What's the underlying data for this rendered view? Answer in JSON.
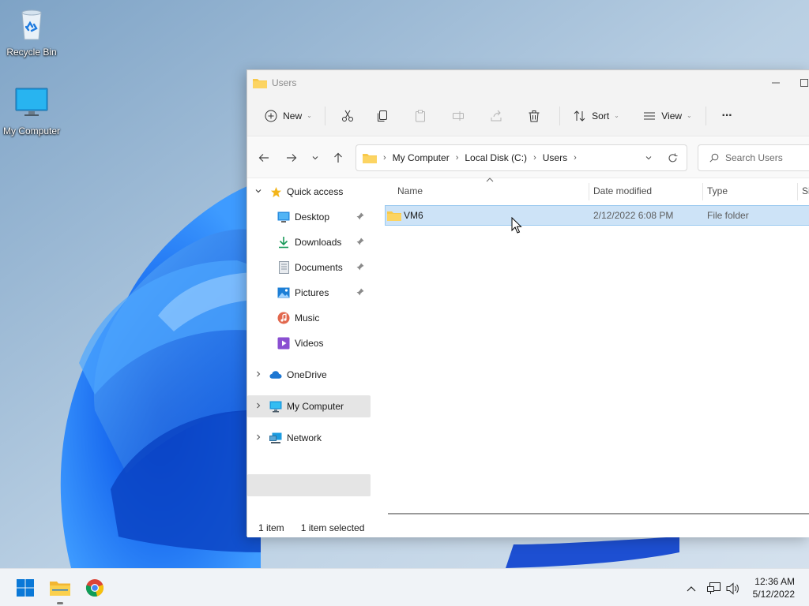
{
  "desktop": {
    "icons": [
      {
        "label": "Recycle Bin",
        "icon": "recycle-bin-icon"
      },
      {
        "label": "My Computer",
        "icon": "monitor-icon"
      }
    ]
  },
  "window": {
    "title": "Users",
    "controls": {
      "minimize": "minimize-icon",
      "maximize": "maximize-icon"
    }
  },
  "toolbar": {
    "new_label": "New",
    "sort_label": "Sort",
    "view_label": "View",
    "more_label": "···",
    "icons": [
      "plus-circle-icon",
      "cut-icon",
      "copy-icon",
      "paste-icon",
      "rename-icon",
      "share-icon",
      "delete-icon",
      "sort-icon",
      "view-icon",
      "more-icon"
    ]
  },
  "address": {
    "crumbs": [
      "My Computer",
      "Local Disk (C:)",
      "Users"
    ],
    "search_placeholder": "Search Users"
  },
  "navpane": {
    "items": [
      {
        "label": "Quick access",
        "icon": "star-icon"
      },
      {
        "label": "Desktop",
        "icon": "desktop-icon",
        "pinned": true
      },
      {
        "label": "Downloads",
        "icon": "download-icon",
        "pinned": true
      },
      {
        "label": "Documents",
        "icon": "documents-icon",
        "pinned": true
      },
      {
        "label": "Pictures",
        "icon": "pictures-icon",
        "pinned": true
      },
      {
        "label": "Music",
        "icon": "music-icon"
      },
      {
        "label": "Videos",
        "icon": "videos-icon"
      },
      {
        "label": "OneDrive",
        "icon": "cloud-icon"
      },
      {
        "label": "My Computer",
        "icon": "monitor-icon",
        "selected": true
      },
      {
        "label": "Network",
        "icon": "network-icon"
      }
    ]
  },
  "filelist": {
    "columns": [
      "Name",
      "Date modified",
      "Type",
      "Si"
    ],
    "rows": [
      {
        "name": "VM6",
        "date": "2/12/2022 6:08 PM",
        "type": "File folder",
        "selected": true
      }
    ]
  },
  "status": {
    "count": "1 item",
    "selection": "1 item selected"
  },
  "taskbar": {
    "time": "12:36 AM",
    "date": "5/12/2022",
    "apps": [
      "start-icon",
      "file-explorer-icon",
      "chrome-icon"
    ],
    "tray": [
      "chevron-up-icon",
      "network-tray-icon",
      "volume-icon"
    ]
  },
  "colors": {
    "accent": "#0078d4",
    "selection_bg": "#cde3f7",
    "selection_border": "#99c9ef",
    "folder": "#f8c94b"
  }
}
